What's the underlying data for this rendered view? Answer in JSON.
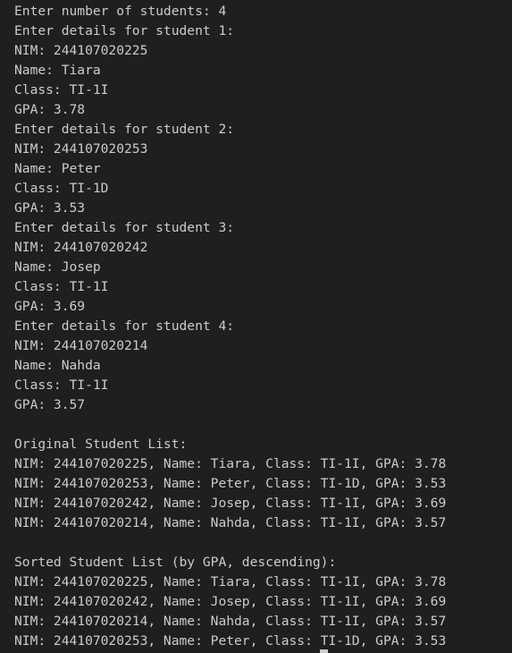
{
  "terminal": {
    "input_section": [
      "Enter number of students: 4",
      "Enter details for student 1:",
      "NIM: 244107020225",
      "Name: Tiara",
      "Class: TI-1I",
      "GPA: 3.78",
      "Enter details for student 2:",
      "NIM: 244107020253",
      "Name: Peter",
      "Class: TI-1D",
      "GPA: 3.53",
      "Enter details for student 3:",
      "NIM: 244107020242",
      "Name: Josep",
      "Class: TI-1I",
      "GPA: 3.69",
      "Enter details for student 4:",
      "NIM: 244107020214",
      "Name: Nahda",
      "Class: TI-1I",
      "GPA: 3.57"
    ],
    "original_list": {
      "heading": "Original Student List:",
      "rows": [
        "NIM: 244107020225, Name: Tiara, Class: TI-1I, GPA: 3.78",
        "NIM: 244107020253, Name: Peter, Class: TI-1D, GPA: 3.53",
        "NIM: 244107020242, Name: Josep, Class: TI-1I, GPA: 3.69",
        "NIM: 244107020214, Name: Nahda, Class: TI-1I, GPA: 3.57"
      ]
    },
    "sorted_list": {
      "heading": "Sorted Student List (by GPA, descending):",
      "rows": [
        "NIM: 244107020225, Name: Tiara, Class: TI-1I, GPA: 3.78",
        "NIM: 244107020242, Name: Josep, Class: TI-1I, GPA: 3.69",
        "NIM: 244107020214, Name: Nahda, Class: TI-1I, GPA: 3.57",
        "NIM: 244107020253, Name: Peter, Class: TI-1D, GPA: 3.53"
      ]
    }
  },
  "colors": {
    "background": "#1f1f1f",
    "foreground": "#cccccc"
  }
}
